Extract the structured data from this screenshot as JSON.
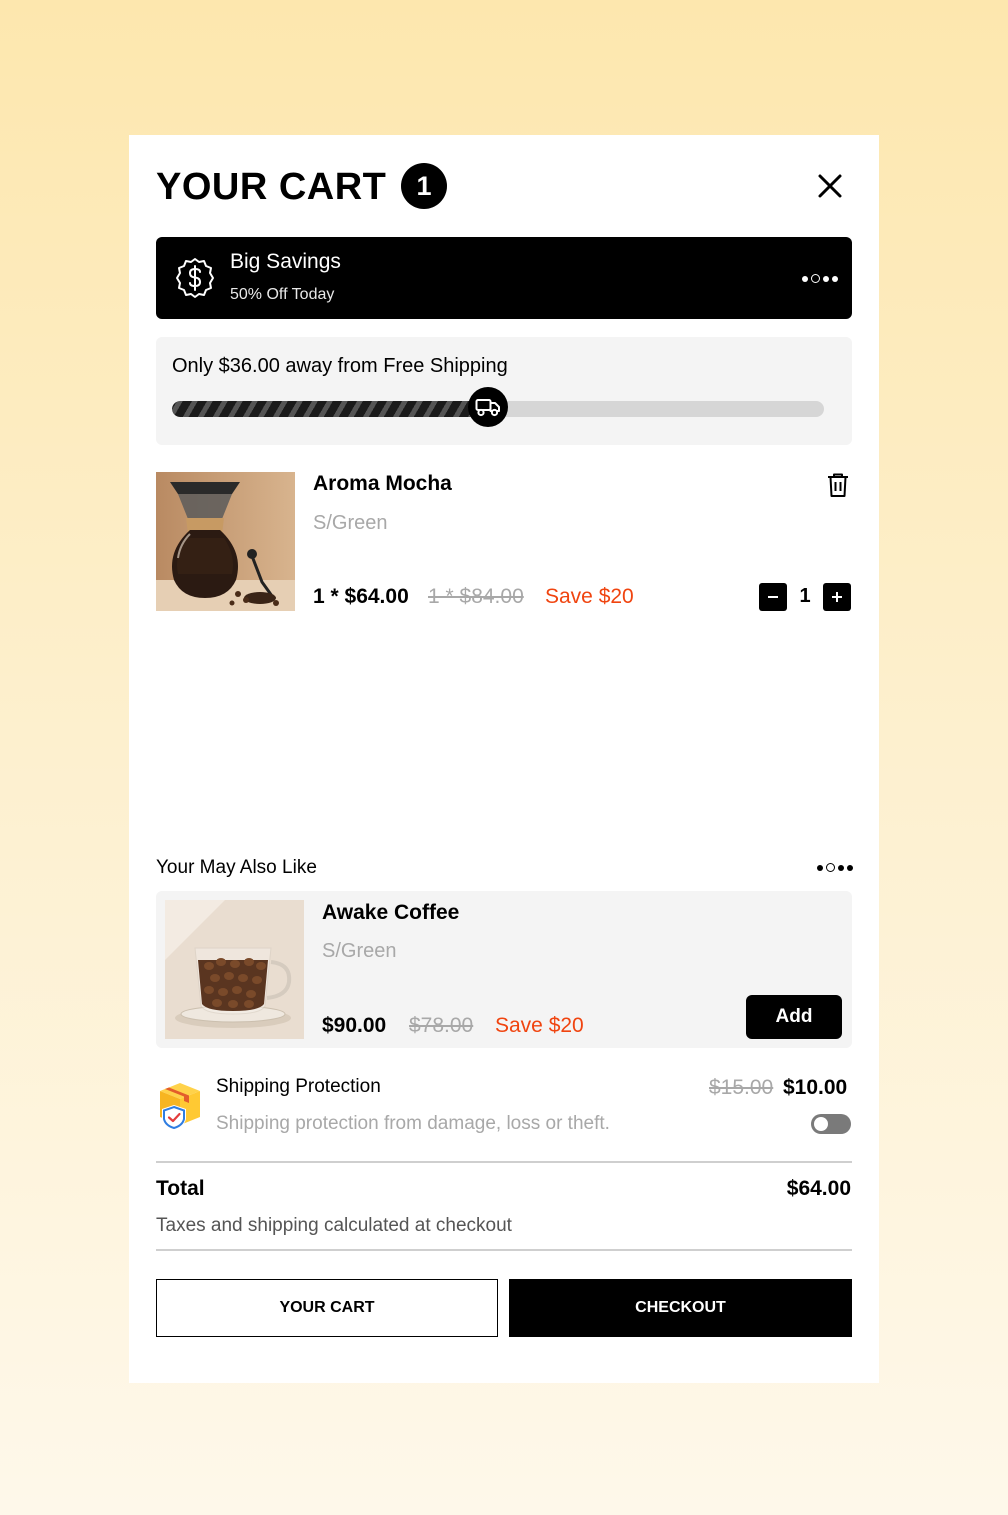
{
  "header": {
    "title": "YOUR CART",
    "count": "1"
  },
  "promo": {
    "title": "Big Savings",
    "subtitle": "50% Off Today"
  },
  "shipping_progress": {
    "message": "Only $36.00 away from Free Shipping",
    "progress": 0.5
  },
  "cart_items": [
    {
      "name": "Aroma Mocha",
      "variant": "S/Green",
      "price": "1 * $64.00",
      "compare_price": "1 * $84.00",
      "savings": "Save $20",
      "quantity": "1"
    }
  ],
  "upsell": {
    "heading": "Your May Also Like",
    "product": {
      "name": "Awake Coffee",
      "variant": "S/Green",
      "price": "$90.00",
      "compare_price": "$78.00",
      "savings": "Save $20",
      "add_label": "Add"
    }
  },
  "protection": {
    "title": "Shipping Protection",
    "description": "Shipping protection from damage, loss or theft.",
    "compare_price": "$15.00",
    "price": "$10.00",
    "enabled": false
  },
  "summary": {
    "total_label": "Total",
    "total_value": "$64.00",
    "note": "Taxes and shipping calculated at checkout"
  },
  "actions": {
    "cart_label": "YOUR CART",
    "checkout_label": "CHECKOUT"
  },
  "colors": {
    "accent": "#f0440f",
    "primary": "#000000",
    "panel": "#f4f4f4"
  },
  "icons": {
    "close": "close-icon",
    "promo": "dollar-badge-icon",
    "truck": "truck-icon",
    "trash": "trash-icon",
    "protection": "shield-package-icon"
  }
}
